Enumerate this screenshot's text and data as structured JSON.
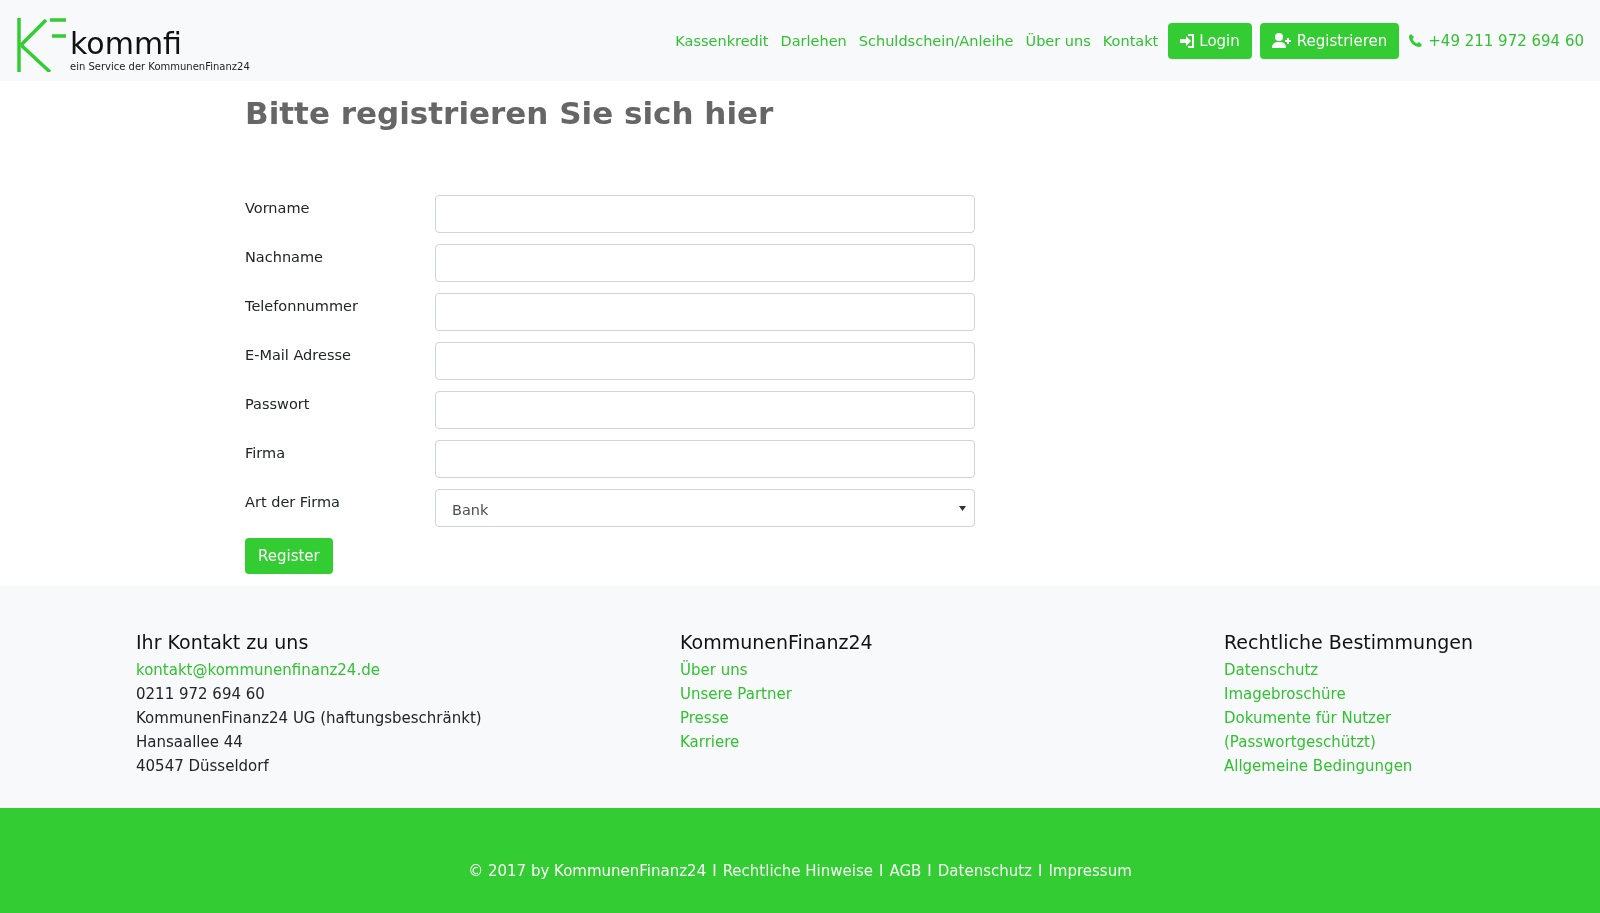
{
  "header": {
    "logo": {
      "name": "kommfi",
      "tagline": "ein Service der KommunenFinanz24"
    },
    "nav": [
      {
        "label": "Kassenkredit",
        "kind": "link"
      },
      {
        "label": "Darlehen",
        "kind": "link"
      },
      {
        "label": "Schuldschein/Anleihe",
        "kind": "link"
      },
      {
        "label": "Über uns",
        "kind": "link"
      },
      {
        "label": "Kontakt",
        "kind": "link"
      },
      {
        "label": "Login",
        "kind": "login"
      },
      {
        "label": "Registrieren",
        "kind": "register"
      },
      {
        "label": "+49 211 972 694 60",
        "kind": "phone"
      }
    ]
  },
  "page": {
    "title": "Bitte registrieren Sie sich hier",
    "fields": [
      {
        "label": "Vorname",
        "kind": "text"
      },
      {
        "label": "Nachname",
        "kind": "text"
      },
      {
        "label": "Telefonnummer",
        "kind": "text"
      },
      {
        "label": "E-Mail Adresse",
        "kind": "text"
      },
      {
        "label": "Passwort",
        "kind": "password"
      },
      {
        "label": "Firma",
        "kind": "text"
      },
      {
        "label": "Art der Firma",
        "kind": "select",
        "value": "Bank"
      }
    ],
    "submit": "Register"
  },
  "footer": {
    "columns": [
      {
        "heading": "Ihr Kontakt zu uns",
        "lines": [
          {
            "text": "kontakt@kommunenfinanz24.de",
            "kind": "link"
          },
          {
            "text": "0211 972 694 60",
            "kind": "text"
          },
          {
            "text": "KommunenFinanz24 UG (haftungsbeschränkt)",
            "kind": "text"
          },
          {
            "text": "Hansaallee 44",
            "kind": "text"
          },
          {
            "text": "40547 Düsseldorf",
            "kind": "text"
          }
        ]
      },
      {
        "heading": "KommunenFinanz24",
        "lines": [
          {
            "text": "Über uns",
            "kind": "link"
          },
          {
            "text": "Unsere Partner",
            "kind": "link"
          },
          {
            "text": "Presse",
            "kind": "link"
          },
          {
            "text": "Karriere",
            "kind": "link"
          }
        ]
      },
      {
        "heading": "Rechtliche Bestimmungen",
        "lines": [
          {
            "text": "Datenschutz",
            "kind": "link"
          },
          {
            "text": "Imagebroschüre",
            "kind": "link"
          },
          {
            "text": "Dokumente für Nutzer",
            "kind": "link"
          },
          {
            "text": "(Passwortgeschützt)",
            "kind": "link"
          },
          {
            "text": "Allgemeine Bedingungen",
            "kind": "link"
          }
        ]
      }
    ],
    "bottom": [
      {
        "text": "© 2017 by KommunenFinanz24",
        "kind": "text"
      },
      {
        "text": "I",
        "kind": "separator"
      },
      {
        "text": "Rechtliche Hinweise",
        "kind": "link"
      },
      {
        "text": "I",
        "kind": "separator"
      },
      {
        "text": "AGB",
        "kind": "link"
      },
      {
        "text": "I",
        "kind": "separator"
      },
      {
        "text": "Datenschutz",
        "kind": "link"
      },
      {
        "text": "I",
        "kind": "separator"
      },
      {
        "text": "Impressum",
        "kind": "link"
      }
    ]
  }
}
